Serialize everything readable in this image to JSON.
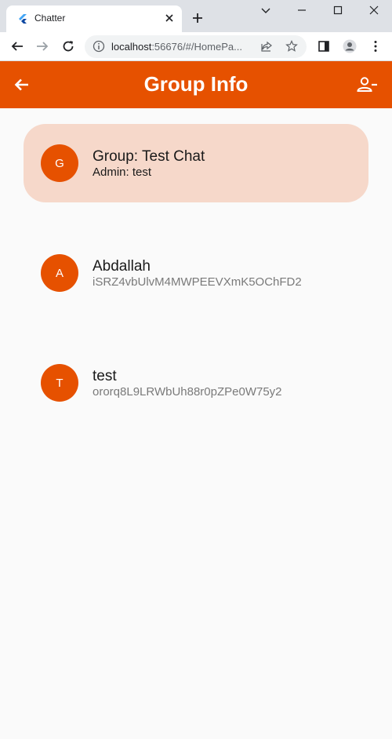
{
  "browser": {
    "tab_title": "Chatter",
    "url_host": "localhost",
    "url_rest": ":56676/#/HomePa..."
  },
  "appbar": {
    "title": "Group Info"
  },
  "group": {
    "avatar_letter": "G",
    "title": "Group: Test Chat",
    "subtitle": "Admin: test"
  },
  "members": [
    {
      "avatar_letter": "A",
      "name": "Abdallah",
      "uid": "iSRZ4vbUlvM4MWPEEVXmK5OChFD2"
    },
    {
      "avatar_letter": "T",
      "name": "test",
      "uid": "ororq8L9LRWbUh88r0pZPe0W75y2"
    }
  ],
  "colors": {
    "accent": "#e65100",
    "group_card": "#f6d8ca",
    "background": "#fafafa"
  }
}
